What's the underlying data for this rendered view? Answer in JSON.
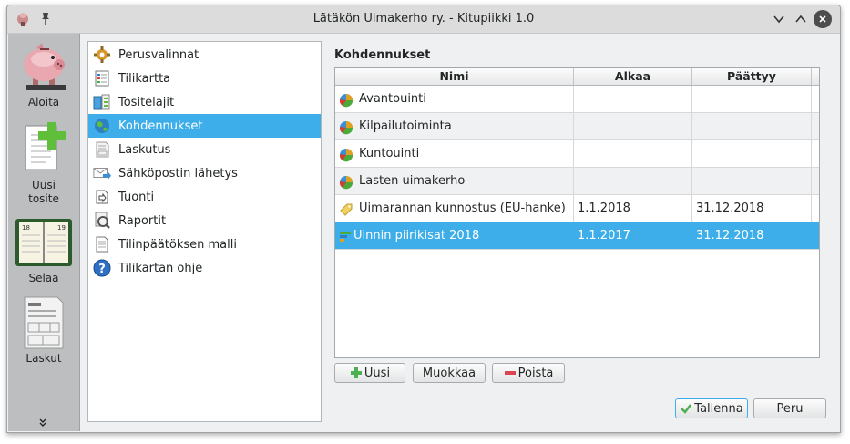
{
  "window": {
    "title": "Lätäkön Uimakerho ry. - Kitupiikki 1.0"
  },
  "titlebar_icons": [
    "app-icon",
    "pin-icon",
    "minimize-icon",
    "maximize-icon",
    "close-icon"
  ],
  "sidebar": {
    "items": [
      {
        "label": "Aloita",
        "icon": "piggy-bank-icon"
      },
      {
        "label": "Uusi tosite",
        "icon": "new-document-icon"
      },
      {
        "label": "Selaa",
        "icon": "ledger-book-icon"
      },
      {
        "label": "Laskut",
        "icon": "invoice-icon"
      }
    ],
    "more_icon": "double-chevron-down-icon"
  },
  "nav": {
    "items": [
      {
        "label": "Perusvalinnat",
        "icon": "settings-icon",
        "selected": false
      },
      {
        "label": "Tilikartta",
        "icon": "chart-of-accounts-icon",
        "selected": false
      },
      {
        "label": "Tositelajit",
        "icon": "document-types-icon",
        "selected": false
      },
      {
        "label": "Kohdennukset",
        "icon": "globe-icon",
        "selected": true
      },
      {
        "label": "Laskutus",
        "icon": "invoice-small-icon",
        "selected": false
      },
      {
        "label": "Sähköpostin lähetys",
        "icon": "email-send-icon",
        "selected": false
      },
      {
        "label": "Tuonti",
        "icon": "import-icon",
        "selected": false
      },
      {
        "label": "Raportit",
        "icon": "report-icon",
        "selected": false
      },
      {
        "label": "Tilinpäätöksen malli",
        "icon": "document-template-icon",
        "selected": false
      },
      {
        "label": "Tilikartan ohje",
        "icon": "help-icon",
        "selected": false
      }
    ]
  },
  "main": {
    "section_title": "Kohdennukset",
    "table": {
      "columns": [
        "Nimi",
        "Alkaa",
        "Päättyy"
      ],
      "rows": [
        {
          "name": "Avantouinti",
          "start": "",
          "end": "",
          "icon": "pie-chart-icon",
          "selected": false
        },
        {
          "name": "Kilpailutoiminta",
          "start": "",
          "end": "",
          "icon": "pie-chart-icon",
          "selected": false
        },
        {
          "name": "Kuntouinti",
          "start": "",
          "end": "",
          "icon": "pie-chart-icon",
          "selected": false
        },
        {
          "name": "Lasten uimakerho",
          "start": "",
          "end": "",
          "icon": "pie-chart-icon",
          "selected": false
        },
        {
          "name": "Uimarannan kunnostus (EU-hanke)",
          "start": "1.1.2018",
          "end": "31.12.2018",
          "icon": "tag-icon",
          "selected": false
        },
        {
          "name": "Uinnin piirikisat 2018",
          "start": "1.1.2017",
          "end": "31.12.2018",
          "icon": "event-icon",
          "selected": true
        }
      ]
    },
    "buttons": {
      "new": "Uusi",
      "edit": "Muokkaa",
      "delete": "Poista",
      "save": "Tallenna",
      "cancel": "Peru"
    }
  },
  "colors": {
    "selection": "#3daee9",
    "window_bg": "#eff0f1",
    "sidebar_bg": "#bcbec0",
    "add_green": "#4caf50",
    "delete_red": "#da4453"
  }
}
